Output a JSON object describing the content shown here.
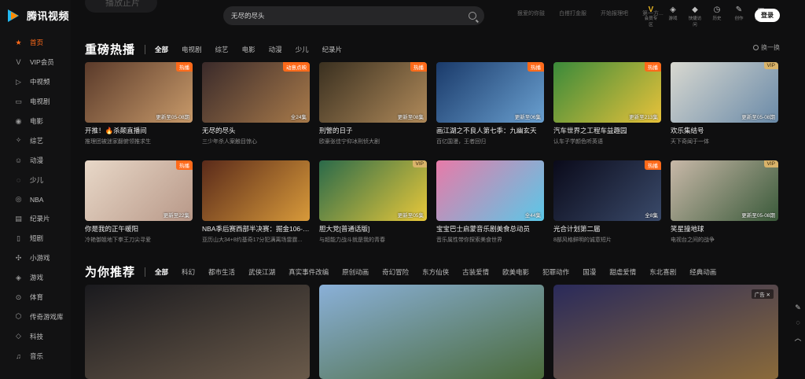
{
  "app": {
    "name": "腾讯视频"
  },
  "topbar": {
    "ghost_button": "播放正片",
    "search": {
      "placeholder": "无尽的尽头"
    },
    "hot_words": [
      "狠爱的你鼓",
      "白搭打金服",
      "开始报理吧",
      "第一方..."
    ],
    "icons": [
      {
        "icon": "vip-icon",
        "label": "会员专区"
      },
      {
        "icon": "game-icon",
        "label": "游戏"
      },
      {
        "icon": "shortcut-icon",
        "label": "快捷访问"
      },
      {
        "icon": "history-icon",
        "label": "历史"
      },
      {
        "icon": "create-icon",
        "label": "创作"
      },
      {
        "icon": "client-icon",
        "label": "客户端"
      }
    ],
    "login": "登录"
  },
  "sidebar": {
    "items": [
      {
        "label": "首页",
        "icon": "star-icon",
        "active": true
      },
      {
        "label": "VIP会员",
        "icon": "vip-v-icon"
      },
      {
        "label": "中视频",
        "icon": "play-square-icon"
      },
      {
        "label": "电视剧",
        "icon": "tv-icon"
      },
      {
        "label": "电影",
        "icon": "film-icon"
      },
      {
        "label": "综艺",
        "icon": "mic-icon"
      },
      {
        "label": "动漫",
        "icon": "anime-icon"
      },
      {
        "label": "少儿",
        "icon": "kids-icon"
      },
      {
        "label": "NBA",
        "icon": "basketball-icon"
      },
      {
        "label": "纪录片",
        "icon": "doc-icon"
      },
      {
        "label": "短剧",
        "icon": "short-drama-icon"
      },
      {
        "label": "小游戏",
        "icon": "mini-game-icon"
      },
      {
        "label": "游戏",
        "icon": "gamepad-icon"
      },
      {
        "label": "体育",
        "icon": "sports-icon"
      },
      {
        "label": "传奇游戏库",
        "icon": "legend-icon"
      },
      {
        "label": "科技",
        "icon": "tech-icon"
      },
      {
        "label": "音乐",
        "icon": "music-icon"
      }
    ]
  },
  "hot_section": {
    "title": "重磅热播",
    "tabs": [
      "全部",
      "电视剧",
      "综艺",
      "电影",
      "动漫",
      "少儿",
      "纪录片"
    ],
    "swap": "换一换",
    "cards": [
      {
        "title": "开推！🔥杀颠直播间",
        "sub": "推理团被迷家翻俯领推求生",
        "badge": "热播",
        "badge_type": "hot",
        "ep": "更新至05-08期",
        "colors": [
          "#5a3a2a",
          "#c89a6a"
        ]
      },
      {
        "title": "无尽的尽头",
        "sub": "三少年杀人案触目惊心",
        "badge": "动意点映",
        "badge_type": "hot",
        "ep": "全24集",
        "colors": [
          "#3a2a2a",
          "#a87a4a"
        ]
      },
      {
        "title": "刑警的日子",
        "sub": "欧豪张佳宁仰冰刑侦大剧",
        "badge": "热播",
        "badge_type": "hot",
        "ep": "更新至08集",
        "colors": [
          "#3a3020",
          "#b08a5a"
        ]
      },
      {
        "title": "画江湖之不良人第七季：九幽玄天",
        "sub": "百亿国漫，王者回归",
        "badge": "热播",
        "badge_type": "hot",
        "ep": "更新至06集",
        "colors": [
          "#1a3a6a",
          "#6aa0d0"
        ]
      },
      {
        "title": "汽车世界之工程车益趣园",
        "sub": "认车子学颜色听英语",
        "badge": "热播",
        "badge_type": "hot",
        "ep": "更新至213集",
        "colors": [
          "#3a8a3a",
          "#e8c23a"
        ]
      },
      {
        "title": "欢乐集结号",
        "sub": "天下奇闻于一体",
        "badge": "VIP",
        "badge_type": "vip",
        "ep": "更新至05-08期",
        "colors": [
          "#d8d8d0",
          "#6a8aa8"
        ]
      },
      {
        "title": "你是我的正午暖阳",
        "sub": "冷艳御姐地下拳王刀尖寻爱",
        "badge": "热播",
        "badge_type": "hot",
        "ep": "更新至22集",
        "colors": [
          "#e8d8c8",
          "#b89888"
        ]
      },
      {
        "title": "NBA季后赛西部半决赛：掘金106-1...",
        "sub": "亚历山大34+8约基奇17分犯满离场雷霆...",
        "badge": "",
        "badge_type": "",
        "ep": "",
        "colors": [
          "#5a2a1a",
          "#d89a3a"
        ]
      },
      {
        "title": "胆大党[普通话版]",
        "sub": "与超能力战斗就是我的青春",
        "badge": "VIP",
        "badge_type": "vip",
        "ep": "更新至05集",
        "colors": [
          "#2a6a4a",
          "#e8c83a"
        ]
      },
      {
        "title": "宝宝巴士启蒙音乐剧美食总动员",
        "sub": "音乐属性带你探索美食世界",
        "badge": "",
        "badge_type": "",
        "ep": "全44集",
        "colors": [
          "#e87aa8",
          "#5ac8e8"
        ]
      },
      {
        "title": "光合计划第二届",
        "sub": "8部风格鲜明的诚意短片",
        "badge": "热播",
        "badge_type": "hot",
        "ep": "全8集",
        "colors": [
          "#0a0a1a",
          "#3a4a6a"
        ]
      },
      {
        "title": "笑星撞地球",
        "sub": "电视台之间的战争",
        "badge": "VIP",
        "badge_type": "vip",
        "ep": "更新至05-08期",
        "colors": [
          "#c8b8a8",
          "#3a5a3a"
        ]
      }
    ]
  },
  "recommend_section": {
    "title": "为你推荐",
    "tabs": [
      "全部",
      "科幻",
      "都市生活",
      "武侠江湖",
      "真实事件改编",
      "原创动画",
      "奇幻冒险",
      "东方仙侠",
      "古装爱情",
      "欧美电影",
      "犯罪动作",
      "国漫",
      "甜虐爱情",
      "东北喜剧",
      "经典动画"
    ],
    "ad_badge": "广告 ✕",
    "big_cards": [
      {
        "colors": [
          "#1a1a1e",
          "#6a5a4a"
        ]
      },
      {
        "colors": [
          "#8ab0d8",
          "#4a6a3a"
        ]
      },
      {
        "colors": [
          "#2a2a5a",
          "#8a6a3a"
        ]
      }
    ]
  },
  "float_tools": [
    "edit-icon",
    "feedback-icon",
    "back-to-top-icon"
  ]
}
